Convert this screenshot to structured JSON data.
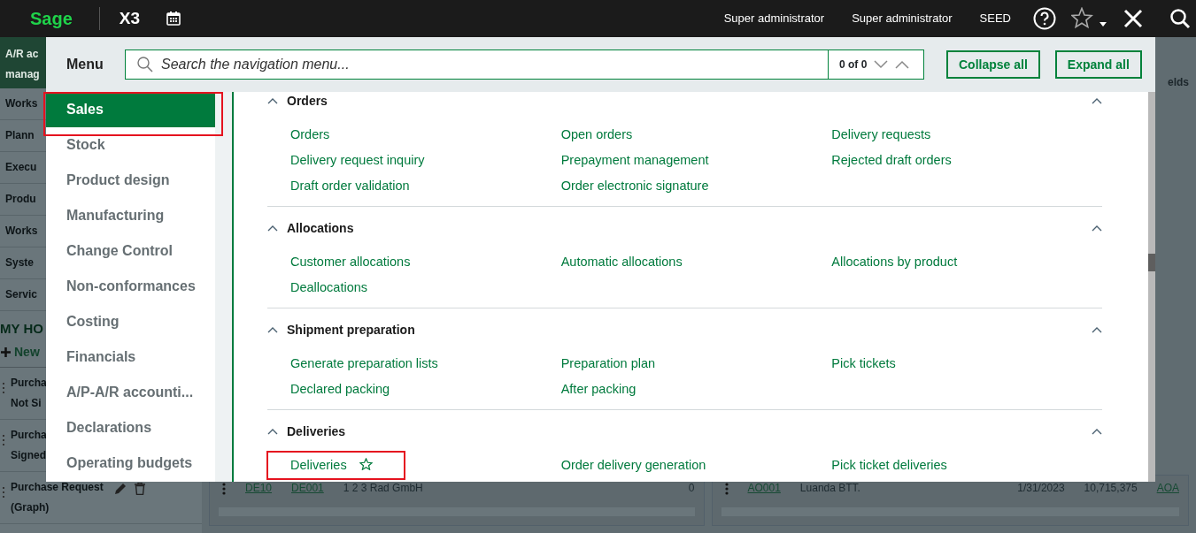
{
  "topbar": {
    "logo": "Sage",
    "product": "X3",
    "user": "Super administrator",
    "role": "Super administrator",
    "folder": "SEED"
  },
  "background": {
    "header_lines": [
      "A/R ac",
      "manag"
    ],
    "sidebar_items": [
      "Works",
      "Plann",
      "Execu",
      "Produ",
      "Works",
      "Syste",
      "Servic"
    ],
    "home_title": "MY HO",
    "new_label": "New",
    "widgets": [
      {
        "lines": [
          "Purcha",
          "Not Si"
        ],
        "actions": false
      },
      {
        "lines": [
          "Purcha",
          "Signed"
        ],
        "actions": false
      },
      {
        "lines": [
          "Purchase Request",
          "(Graph)"
        ],
        "actions": true
      }
    ],
    "right_label": "elds",
    "tables": [
      {
        "cells": [
          {
            "text": "DE10",
            "kind": "link"
          },
          {
            "text": "DE001",
            "kind": "link"
          },
          {
            "text": "1 2 3 Rad GmbH",
            "kind": "text"
          },
          {
            "text": "0",
            "kind": "number"
          }
        ]
      },
      {
        "cells": [
          {
            "text": "AO001",
            "kind": "link"
          },
          {
            "text": "Luanda BTT.",
            "kind": "text"
          },
          {
            "text": "1/31/2023",
            "kind": "number"
          },
          {
            "text": "10,715,375",
            "kind": "number"
          },
          {
            "text": "AOA",
            "kind": "link"
          }
        ]
      }
    ]
  },
  "menu": {
    "title": "Menu",
    "search": {
      "placeholder": "Search the navigation menu...",
      "counter": "0 of 0"
    },
    "buttons": [
      "Collapse all",
      "Expand all"
    ],
    "modules": [
      {
        "label": "Sales",
        "selected": true,
        "annotated": true
      },
      {
        "label": "Stock",
        "selected": false,
        "annotated": false
      },
      {
        "label": "Product design",
        "selected": false,
        "annotated": false
      },
      {
        "label": "Manufacturing",
        "selected": false,
        "annotated": false
      },
      {
        "label": "Change Control",
        "selected": false,
        "annotated": false
      },
      {
        "label": "Non-conformances",
        "selected": false,
        "annotated": false
      },
      {
        "label": "Costing",
        "selected": false,
        "annotated": false
      },
      {
        "label": "Financials",
        "selected": false,
        "annotated": false
      },
      {
        "label": "A/P-A/R accounti...",
        "selected": false,
        "annotated": false
      },
      {
        "label": "Declarations",
        "selected": false,
        "annotated": false
      },
      {
        "label": "Operating budgets",
        "selected": false,
        "annotated": false
      }
    ],
    "sections": [
      {
        "title": "Orders",
        "expanded": true,
        "links": [
          {
            "label": "Orders",
            "favorite": false,
            "annotated": false
          },
          {
            "label": "Open orders",
            "favorite": false,
            "annotated": false
          },
          {
            "label": "Delivery requests",
            "favorite": false,
            "annotated": false
          },
          {
            "label": "Delivery request inquiry",
            "favorite": false,
            "annotated": false
          },
          {
            "label": "Prepayment management",
            "favorite": false,
            "annotated": false
          },
          {
            "label": "Rejected draft orders",
            "favorite": false,
            "annotated": false
          },
          {
            "label": "Draft order validation",
            "favorite": false,
            "annotated": false
          },
          {
            "label": "Order electronic signature",
            "favorite": false,
            "annotated": false
          }
        ]
      },
      {
        "title": "Allocations",
        "expanded": true,
        "links": [
          {
            "label": "Customer allocations",
            "favorite": false,
            "annotated": false
          },
          {
            "label": "Automatic allocations",
            "favorite": false,
            "annotated": false
          },
          {
            "label": "Allocations by product",
            "favorite": false,
            "annotated": false
          },
          {
            "label": "Deallocations",
            "favorite": false,
            "annotated": false
          }
        ]
      },
      {
        "title": "Shipment preparation",
        "expanded": true,
        "links": [
          {
            "label": "Generate preparation lists",
            "favorite": false,
            "annotated": false
          },
          {
            "label": "Preparation plan",
            "favorite": false,
            "annotated": false
          },
          {
            "label": "Pick tickets",
            "favorite": false,
            "annotated": false
          },
          {
            "label": "Declared packing",
            "favorite": false,
            "annotated": false
          },
          {
            "label": "After packing",
            "favorite": false,
            "annotated": false
          }
        ]
      },
      {
        "title": "Deliveries",
        "expanded": true,
        "links": [
          {
            "label": "Deliveries",
            "favorite": true,
            "annotated": true
          },
          {
            "label": "Order delivery generation",
            "favorite": false,
            "annotated": false
          },
          {
            "label": "Pick ticket deliveries",
            "favorite": false,
            "annotated": false
          }
        ]
      }
    ]
  }
}
